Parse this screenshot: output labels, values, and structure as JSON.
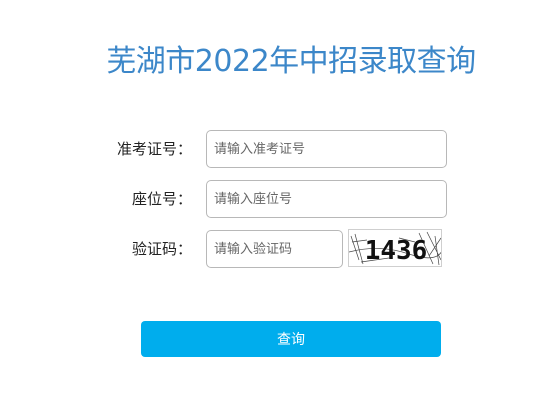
{
  "title": "芜湖市2022年中招录取查询",
  "form": {
    "admission_label": "准考证号：",
    "admission_placeholder": "请输入准考证号",
    "seat_label": "座位号：",
    "seat_placeholder": "请输入座位号",
    "captcha_label": "验证码：",
    "captcha_placeholder": "请输入验证码",
    "captcha_text": "1436"
  },
  "submit_label": "查询",
  "colors": {
    "title": "#3c87c9",
    "button": "#00aded"
  }
}
